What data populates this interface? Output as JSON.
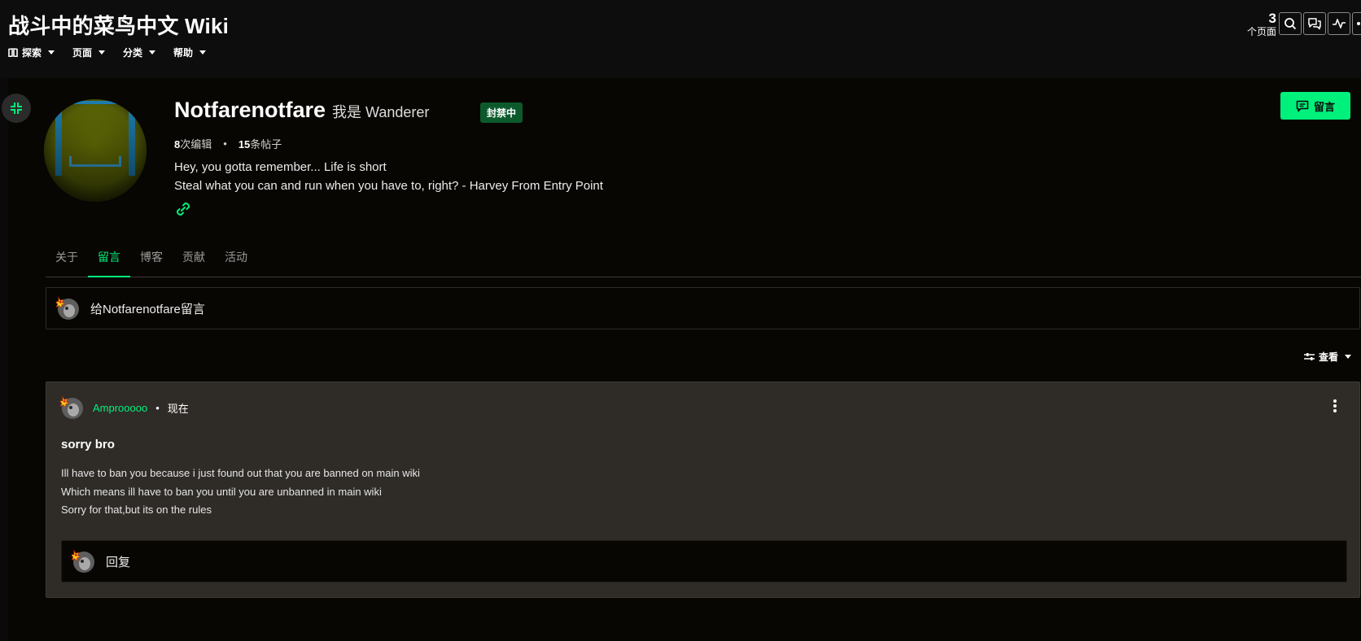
{
  "header": {
    "wiki_title": "战斗中的菜鸟中文 Wiki",
    "nav": [
      {
        "label": "探索",
        "icon": "explore-icon"
      },
      {
        "label": "页面"
      },
      {
        "label": "分类"
      },
      {
        "label": "帮助"
      }
    ],
    "page_count": "3",
    "page_count_label": "个页面",
    "icons": [
      "search-icon",
      "discussions-icon",
      "activity-icon",
      "more-icon"
    ]
  },
  "profile": {
    "username": "Notfarenotfare",
    "tagline": "我是 Wanderer",
    "status_badge": "封禁中",
    "edits_count": "8",
    "edits_label": "次编辑",
    "posts_count": "15",
    "posts_label": "条帖子",
    "bio_line1": "Hey, you gotta remember... Life is short",
    "bio_line2": "Steal what you can and run when you have to, right? - Harvey From Entry Point",
    "leave_message_button": "留言"
  },
  "tabs": [
    {
      "label": "关于",
      "active": false
    },
    {
      "label": "留言",
      "active": true
    },
    {
      "label": "博客",
      "active": false
    },
    {
      "label": "贡献",
      "active": false
    },
    {
      "label": "活动",
      "active": false
    }
  ],
  "compose": {
    "placeholder": "给Notfarenotfare留言"
  },
  "view_button": "查看",
  "message": {
    "author": "Amprooooo",
    "time": "现在",
    "title": "sorry bro",
    "body": [
      "Ill have to ban you because i just found out that you are banned on main wiki",
      "Which means ill have to ban you until you are unbanned in main wiki",
      "Sorry for that,but its on the rules"
    ],
    "reply_placeholder": "回复"
  },
  "colors": {
    "accent": "#00f17b",
    "background": "#080602",
    "card": "#2f2c28",
    "badge": "#0c5a2c"
  }
}
